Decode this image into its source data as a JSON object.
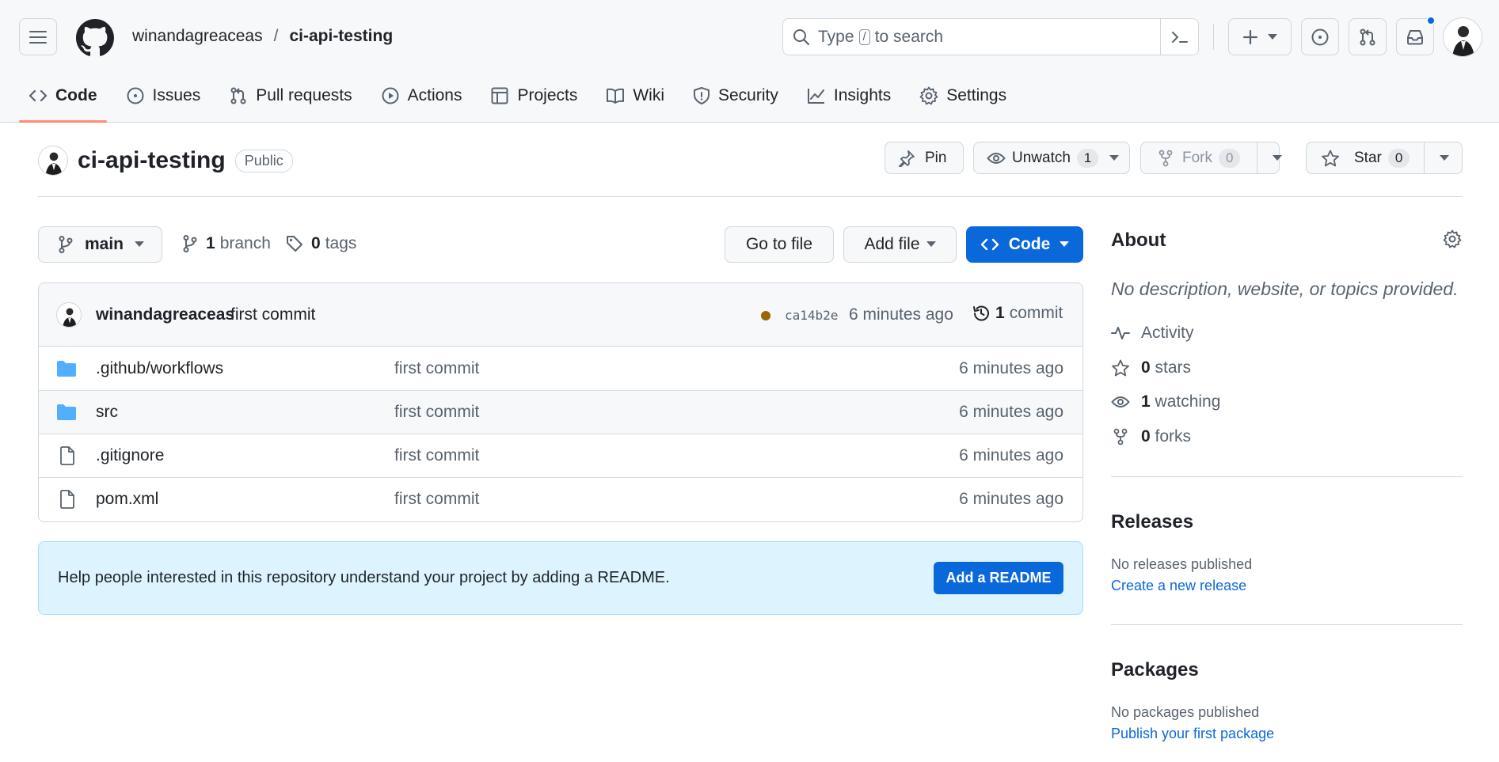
{
  "header": {
    "owner": "winandagreaceas",
    "separator": "/",
    "repo": "ci-api-testing",
    "search_before": "Type",
    "search_key": "/",
    "search_after": "to search"
  },
  "tabs": [
    {
      "label": "Code",
      "icon": "code-icon"
    },
    {
      "label": "Issues",
      "icon": "issue-icon"
    },
    {
      "label": "Pull requests",
      "icon": "pull-request-icon"
    },
    {
      "label": "Actions",
      "icon": "play-icon"
    },
    {
      "label": "Projects",
      "icon": "table-icon"
    },
    {
      "label": "Wiki",
      "icon": "book-icon"
    },
    {
      "label": "Security",
      "icon": "shield-icon"
    },
    {
      "label": "Insights",
      "icon": "graph-icon"
    },
    {
      "label": "Settings",
      "icon": "gear-icon"
    }
  ],
  "repo": {
    "name": "ci-api-testing",
    "visibility": "Public",
    "pin_label": "Pin",
    "unwatch_label": "Unwatch",
    "unwatch_count": "1",
    "fork_label": "Fork",
    "fork_count": "0",
    "star_label": "Star",
    "star_count": "0"
  },
  "toolbar": {
    "branch": "main",
    "branch_count": "1",
    "branch_label": "branch",
    "tag_count": "0",
    "tag_label": "tags",
    "go_to_file": "Go to file",
    "add_file": "Add file",
    "code": "Code"
  },
  "commit": {
    "author": "winandagreaceas",
    "message": "first commit",
    "hash": "ca14b2e",
    "time": "6 minutes ago",
    "count": "1",
    "count_label": "commit",
    "status_color": "#9a6700"
  },
  "files": [
    {
      "name": ".github/workflows",
      "type": "folder",
      "message": "first commit",
      "time": "6 minutes ago"
    },
    {
      "name": "src",
      "type": "folder",
      "message": "first commit",
      "time": "6 minutes ago"
    },
    {
      "name": ".gitignore",
      "type": "file",
      "message": "first commit",
      "time": "6 minutes ago"
    },
    {
      "name": "pom.xml",
      "type": "file",
      "message": "first commit",
      "time": "6 minutes ago"
    }
  ],
  "readme_banner": {
    "text": "Help people interested in this repository understand your project by adding a README.",
    "button": "Add a README"
  },
  "about": {
    "title": "About",
    "description": "No description, website, or topics provided.",
    "activity": "Activity",
    "stars_count": "0",
    "stars_label": "stars",
    "watching_count": "1",
    "watching_label": "watching",
    "forks_count": "0",
    "forks_label": "forks"
  },
  "releases": {
    "title": "Releases",
    "empty": "No releases published",
    "link": "Create a new release"
  },
  "packages": {
    "title": "Packages",
    "empty": "No packages published",
    "link": "Publish your first package"
  },
  "colors": {
    "accent": "#0969da",
    "primary_button": "#0969da",
    "folder": "#54aeff",
    "tab_underline": "#fd8c73",
    "notification_dot": "#0969da"
  }
}
